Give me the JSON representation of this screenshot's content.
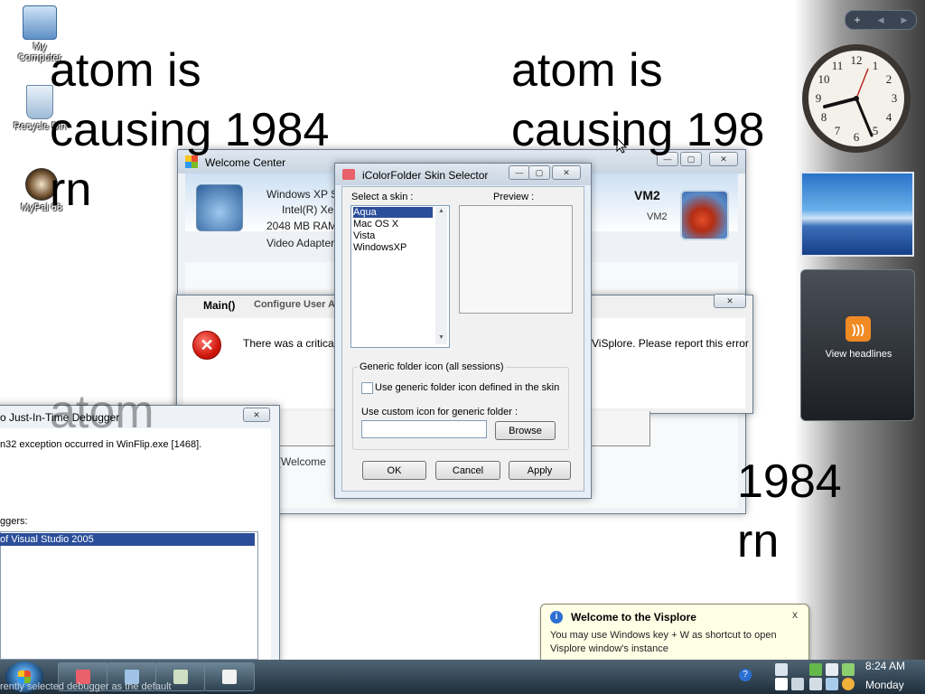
{
  "desktop": {
    "icons": [
      {
        "label": "My Computer"
      },
      {
        "label": "Recycle Bin"
      },
      {
        "label": "MyPal 68"
      }
    ],
    "overlay_text": {
      "left_top": "atom is\ncausing 1984\nrn",
      "right_top": "atom is\ncausing 198",
      "left_mid": "atom",
      "right_bottom": "1984\nrn"
    }
  },
  "sidebar": {
    "controls": [
      "+",
      "◀",
      "▶"
    ],
    "feeds_label": "View headlines",
    "clock": {
      "time": "8:24"
    }
  },
  "welcome_center": {
    "title": "Welcome Center",
    "lines": [
      "Windows XP S",
      "Intel(R) Xe",
      "2048 MB RAM",
      "Video Adapter"
    ],
    "vm_title": "VM2",
    "vm_sub": "VM2",
    "body_text": "p (Welcome"
  },
  "error_dialog": {
    "tab": "Main()",
    "config_label": "Configure User Ac",
    "message_start": "There was a critical",
    "message_end": "ViSplore. Please report this error",
    "close": "✕"
  },
  "debugger": {
    "title": "o Just-In-Time Debugger",
    "message": "n32 exception occurred in WinFlip.exe [1468].",
    "list_label": "ggers:",
    "selected_item": "of Visual Studio 2005",
    "footer": "rently selected debugger as the default"
  },
  "icolorfolder": {
    "title": "iColorFolder Skin Selector",
    "select_label": "Select a skin :",
    "preview_label": "Preview :",
    "skins": [
      "Aqua",
      "Mac OS X",
      "Vista",
      "WindowsXP"
    ],
    "selected_index": 0,
    "group_title": "Generic folder icon (all sessions)",
    "checkbox_label": "Use generic folder icon defined in the skin",
    "custom_label": "Use custom icon for generic folder :",
    "custom_value": "",
    "browse": "Browse",
    "ok": "OK",
    "cancel": "Cancel",
    "apply": "Apply"
  },
  "balloon": {
    "title": "Welcome to the Visplore",
    "line1": "You may use Windows key + W as shortcut to open",
    "line2": "Visplore window's instance",
    "close": "x"
  },
  "taskbar": {
    "time": "8:24 AM",
    "day": "Monday"
  },
  "colors": {
    "accent": "#2b4e9a",
    "taskbar": "#2f4352",
    "error_red": "#d0180c",
    "rss": "#f08a24"
  }
}
